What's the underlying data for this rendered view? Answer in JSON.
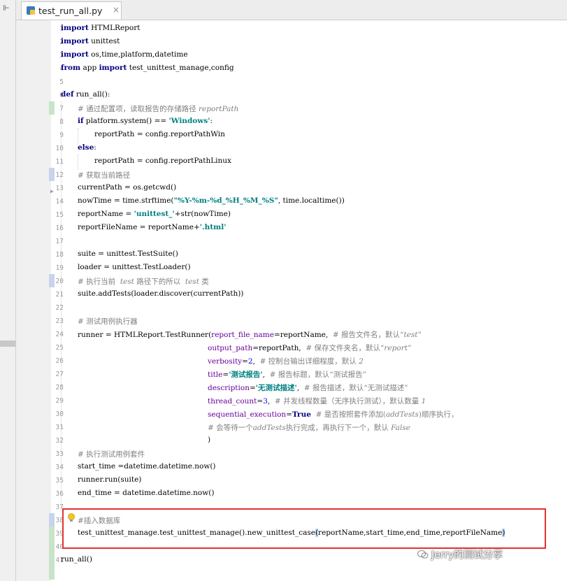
{
  "tab": {
    "filename": "test_run_all.py",
    "close_glyph": "×",
    "icon": "python-file-icon"
  },
  "sidebar": {
    "icon_glyph": "⊩"
  },
  "watermark": {
    "text": "Jerry的测试分享",
    "icon": "wechat-icon"
  },
  "line_numbers": [
    "1",
    "2",
    "3",
    "4",
    "5",
    "6",
    "7",
    "8",
    "9",
    "10",
    "11",
    "12",
    "13",
    "14",
    "15",
    "16",
    "17",
    "18",
    "19",
    "20",
    "21",
    "22",
    "23",
    "24",
    "25",
    "26",
    "27",
    "28",
    "29",
    "30",
    "31",
    "32",
    "33",
    "34",
    "35",
    "36",
    "37",
    "38",
    "39",
    "40",
    "41"
  ],
  "code": {
    "l1": [
      "import",
      " HTMLReport"
    ],
    "l2": [
      "import",
      " unittest"
    ],
    "l3": [
      "import",
      " os,time,platform,datetime"
    ],
    "l4": [
      "from",
      " app ",
      "import",
      " test_unittest_manage,config"
    ],
    "l6": [
      "def",
      " run_all():"
    ],
    "l7": [
      "# 通过配置项，读取报告的存储路径 ",
      "reportPath"
    ],
    "l8": [
      "if",
      " platform.system() == ",
      "'Windows'",
      ":"
    ],
    "l9": [
      "reportPath = config.reportPathWin"
    ],
    "l10": [
      "else",
      ":"
    ],
    "l11": [
      "reportPath = config.reportPathLinux"
    ],
    "l12": [
      "# 获取当前路径"
    ],
    "l13": [
      "currentPath = os.getcwd()"
    ],
    "l14": [
      "nowTime = time.strftime(",
      "\"%Y-%m-%d_%H_%M_%S\"",
      ", time.localtime())"
    ],
    "l15": [
      "reportName = ",
      "'unittest_'",
      "+str(nowTime)"
    ],
    "l16": [
      "reportFileName = reportName+",
      "'.html'"
    ],
    "l18": [
      "suite = unittest.TestSuite()"
    ],
    "l19": [
      "loader = unittest.TestLoader()"
    ],
    "l20": [
      "# 执行当前  ",
      "test",
      " 路径下的所以  ",
      "test",
      " 类"
    ],
    "l21": [
      "suite.addTests(loader.discover(currentPath))"
    ],
    "l23": [
      "# 测试用例执行器"
    ],
    "l24": [
      "runner = HTMLReport.TestRunner(",
      "report_file_name",
      "=reportName,  ",
      "# 报告文件名，默认“",
      "test",
      "”"
    ],
    "l25": [
      "output_path",
      "=reportPath,  ",
      "# 保存文件夹名，默认“",
      "report",
      "”"
    ],
    "l26": [
      "verbosity",
      "=",
      "2",
      ",  ",
      "# 控制台输出详细程度，默认 ",
      "2"
    ],
    "l27": [
      "title",
      "=",
      "'测试报告'",
      ",  ",
      "# 报告标题，默认“测试报告”"
    ],
    "l28": [
      "description",
      "=",
      "'无测试描述'",
      ",  ",
      "# 报告描述，默认“无测试描述”"
    ],
    "l29": [
      "thread_count",
      "=",
      "3",
      ",  ",
      "# 并发线程数量（无序执行测试），默认数量 ",
      "1"
    ],
    "l30": [
      "sequential_execution",
      "=",
      "True",
      "  ",
      "# 是否按照套件添加(",
      "addTests",
      ")顺序执行，"
    ],
    "l31": [
      "# 会等待一个",
      "addTests",
      "执行完成，再执行下一个，默认 ",
      "False"
    ],
    "l32": [
      ")"
    ],
    "l33": [
      "# 执行测试用例套件"
    ],
    "l34": [
      "start_time =datetime.datetime.now()"
    ],
    "l35": [
      "runner.run(suite)"
    ],
    "l36": [
      "end_time = datetime.datetime.now()"
    ],
    "l38": [
      "#插入数据库"
    ],
    "l39": [
      "test_unittest_manage.test_unittest_manage().new_unittest_case",
      "(",
      "reportName,start_time,end_time,reportFileName",
      ")"
    ],
    "l41": [
      "run_all()"
    ]
  }
}
